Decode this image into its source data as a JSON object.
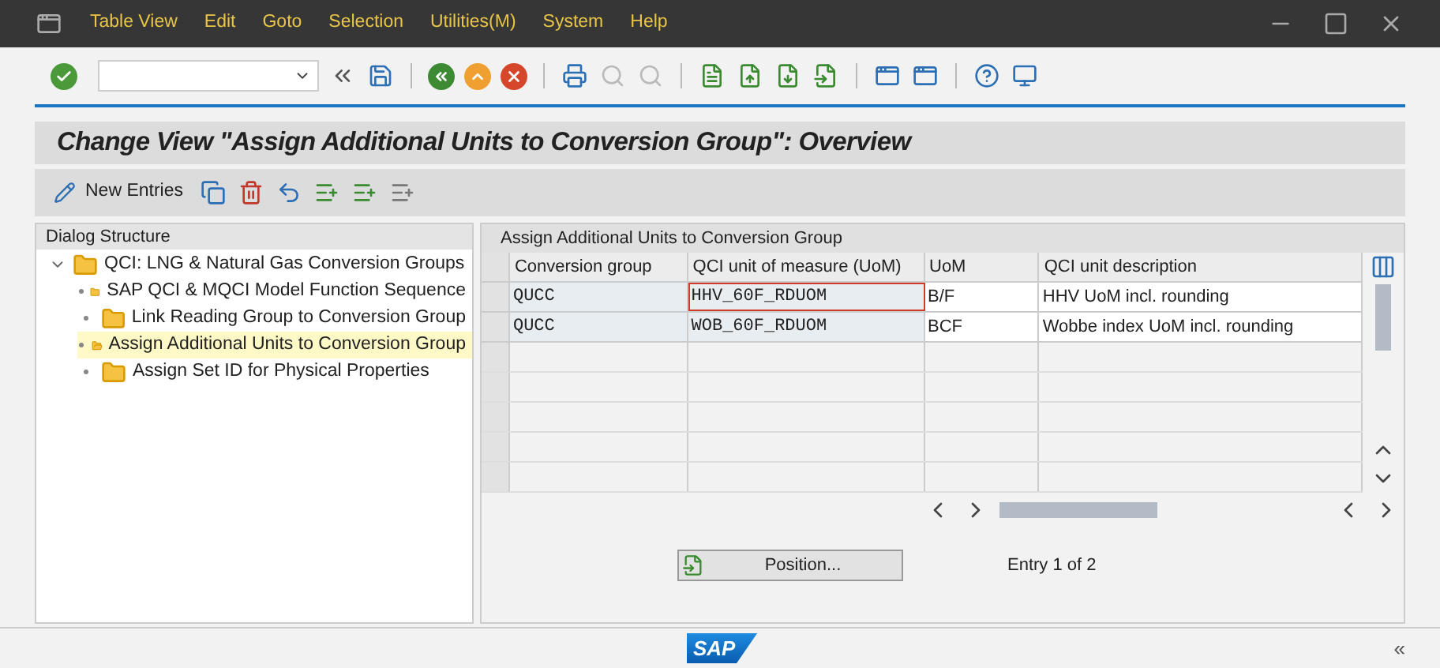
{
  "menu": [
    {
      "label": "Table View"
    },
    {
      "label": "Edit"
    },
    {
      "label": "Goto"
    },
    {
      "label": "Selection"
    },
    {
      "label": "Utilities(M)"
    },
    {
      "label": "System"
    },
    {
      "label": "Help"
    }
  ],
  "title": "Change View \"Assign Additional Units to Conversion Group\": Overview",
  "app_toolbar": {
    "new_entries": "New Entries"
  },
  "dialog_structure": {
    "heading": "Dialog Structure",
    "items": [
      {
        "label": "QCI: LNG & Natural Gas Conversion Groups",
        "expanded": true,
        "selected": false,
        "children": [
          {
            "label": "SAP QCI & MQCI Model Function Sequence",
            "selected": false
          },
          {
            "label": "Link Reading Group to Conversion Group",
            "selected": false
          },
          {
            "label": "Assign Additional Units to Conversion Group",
            "selected": true
          },
          {
            "label": "Assign Set ID for Physical Properties",
            "selected": false
          }
        ]
      }
    ]
  },
  "table": {
    "title": "Assign Additional Units to Conversion Group",
    "columns": [
      "Conversion group",
      "QCI unit of measure (UoM)",
      "UoM",
      "QCI unit description"
    ],
    "rows": [
      {
        "cells": [
          "QUCC",
          "HHV_60F_RDUOM",
          "B/F",
          "HHV UoM incl. rounding"
        ],
        "focused": true
      },
      {
        "cells": [
          "QUCC",
          "WOB_60F_RDUOM",
          "BCF",
          "Wobbe index UoM incl. rounding"
        ],
        "focused": false
      }
    ]
  },
  "position_button": "Position...",
  "entry_info": "Entry 1 of 2",
  "logo": "SAP",
  "collapse": "«"
}
